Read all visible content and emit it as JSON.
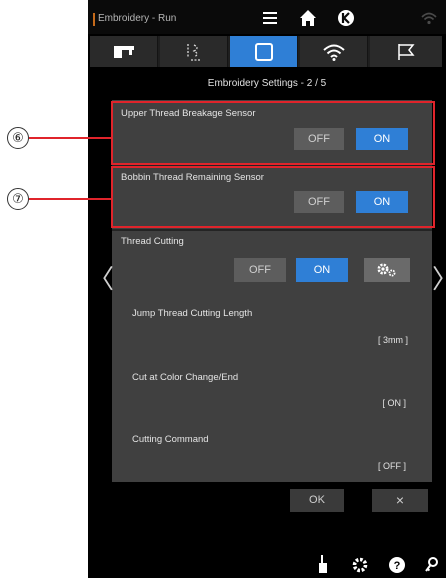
{
  "status_bar": {
    "title": "Embroidery - Run",
    "icons": [
      "menu-icon",
      "home-icon",
      "back-icon",
      "wifi-signal-icon"
    ]
  },
  "tabs": [
    {
      "name": "sewing-machine-icon",
      "active": false
    },
    {
      "name": "stitch-icon",
      "active": false
    },
    {
      "name": "square-icon",
      "active": true
    },
    {
      "name": "wifi-icon",
      "active": false
    },
    {
      "name": "flag-icon",
      "active": false
    }
  ],
  "panel": {
    "title": "Embroidery Settings - 2 / 5"
  },
  "upper_thread": {
    "label": "Upper Thread Breakage Sensor",
    "off": "OFF",
    "on": "ON",
    "selected": "ON"
  },
  "bobbin_thread": {
    "label": "Bobbin Thread Remaining Sensor",
    "off": "OFF",
    "on": "ON",
    "selected": "ON"
  },
  "thread_cutting": {
    "label": "Thread Cutting",
    "off": "OFF",
    "on": "ON",
    "selected": "ON",
    "settings_icon": "gears-icon"
  },
  "jump_thread": {
    "label": "Jump Thread Cutting Length",
    "value": "[ 3mm ]"
  },
  "cut_color": {
    "label": "Cut at Color Change/End",
    "value": "[ ON ]"
  },
  "cutting_command": {
    "label": "Cutting Command",
    "value": "[ OFF ]"
  },
  "dialog": {
    "ok": "OK",
    "close": "×"
  },
  "nav": {
    "prev": "〈",
    "next": "〉"
  },
  "callouts": {
    "six": "⑥",
    "seven": "⑦"
  },
  "bottom_icons": [
    "needle-icon",
    "settings-icon",
    "help-icon",
    "key-icon"
  ],
  "colors": {
    "accent": "#2f7fd6",
    "highlight": "#e0242b",
    "panel": "#404040",
    "background": "#000000"
  }
}
